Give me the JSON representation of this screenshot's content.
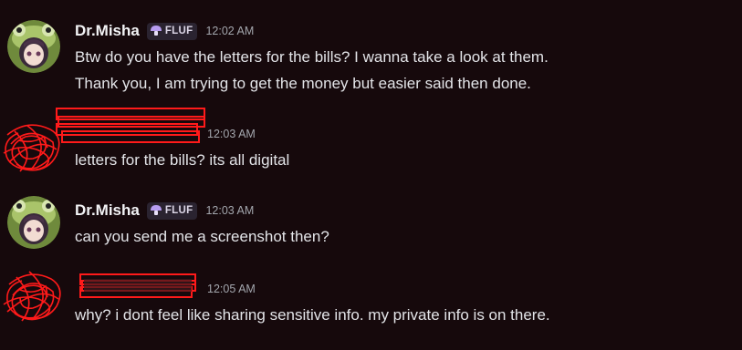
{
  "messages": [
    {
      "author": "Dr.Misha",
      "tag": "FLUF",
      "time": "12:02 AM",
      "lines": [
        "Btw do you have the letters for the bills? I wanna take a look at them.",
        "Thank you, I am trying to get the money but easier said then done."
      ]
    },
    {
      "author": "",
      "time": "12:03 AM",
      "lines": [
        "letters for the bills? its all digital"
      ]
    },
    {
      "author": "Dr.Misha",
      "tag": "FLUF",
      "time": "12:03 AM",
      "lines": [
        "can you send me a screenshot then?"
      ]
    },
    {
      "author": "",
      "time": "12:05 AM",
      "lines": [
        "why? i dont feel like sharing sensitive info. my private info is on there."
      ]
    }
  ],
  "icons": {
    "tag_icon": "mushroom-icon",
    "avatar": "frog-hat-avatar",
    "redaction": "red-scribble"
  },
  "colors": {
    "background": "#16090c",
    "tag_accent": "#b79cf0",
    "redaction": "#ff1a1a"
  }
}
